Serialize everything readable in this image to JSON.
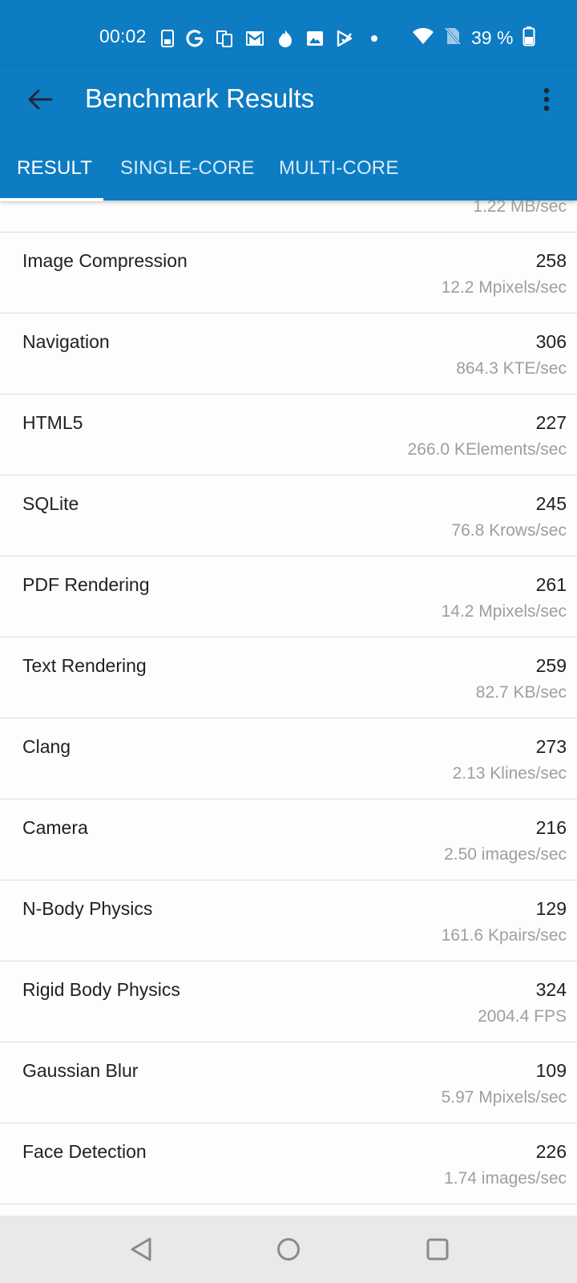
{
  "status_bar": {
    "time": "00:02",
    "battery_text": "39 %",
    "icons": [
      "sim-card-icon",
      "google-icon",
      "copy-icon",
      "gmail-icon",
      "fire-icon",
      "image-icon",
      "play-store-icon",
      "dot-icon"
    ],
    "right_icons": [
      "wifi-icon",
      "no-sim-icon",
      "battery-icon"
    ]
  },
  "app_bar": {
    "title": "Benchmark Results",
    "back_icon": "arrow-back-icon",
    "menu_icon": "more-vert-icon",
    "background_color": "#0d7cc2"
  },
  "tabs": [
    {
      "label": "RESULT",
      "active": true
    },
    {
      "label": "SINGLE-CORE",
      "active": false
    },
    {
      "label": "MULTI-CORE",
      "active": false
    }
  ],
  "partial_row": {
    "rate": "1.22 MB/sec"
  },
  "benchmarks": [
    {
      "name": "Image Compression",
      "score": "258",
      "rate": "12.2 Mpixels/sec"
    },
    {
      "name": "Navigation",
      "score": "306",
      "rate": "864.3 KTE/sec"
    },
    {
      "name": "HTML5",
      "score": "227",
      "rate": "266.0 KElements/sec"
    },
    {
      "name": "SQLite",
      "score": "245",
      "rate": "76.8 Krows/sec"
    },
    {
      "name": "PDF Rendering",
      "score": "261",
      "rate": "14.2 Mpixels/sec"
    },
    {
      "name": "Text Rendering",
      "score": "259",
      "rate": "82.7 KB/sec"
    },
    {
      "name": "Clang",
      "score": "273",
      "rate": "2.13 Klines/sec"
    },
    {
      "name": "Camera",
      "score": "216",
      "rate": "2.50 images/sec"
    },
    {
      "name": "N-Body Physics",
      "score": "129",
      "rate": "161.6 Kpairs/sec"
    },
    {
      "name": "Rigid Body Physics",
      "score": "324",
      "rate": "2004.4 FPS"
    },
    {
      "name": "Gaussian Blur",
      "score": "109",
      "rate": "5.97 Mpixels/sec"
    },
    {
      "name": "Face Detection",
      "score": "226",
      "rate": "1.74 images/sec"
    }
  ],
  "nav_bar": {
    "buttons": [
      "back-triangle-icon",
      "home-circle-icon",
      "recents-square-icon"
    ]
  }
}
